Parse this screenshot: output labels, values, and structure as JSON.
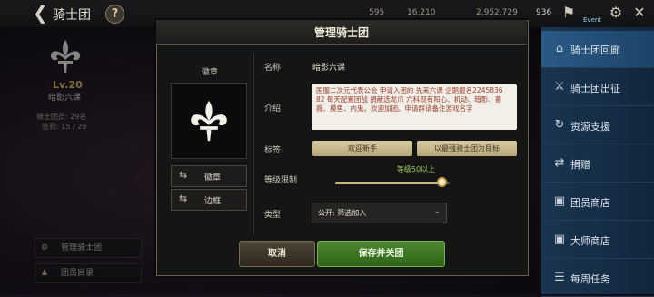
{
  "topbar": {
    "title": "骑士团",
    "help": "?",
    "currencies": [
      "595",
      "16,210",
      "2,952,729",
      "936"
    ],
    "notice": "Event"
  },
  "left_panel": {
    "level": "Lv.20",
    "guild_name": "暗影六课",
    "members": "骑士团员: 29名",
    "donate": "签到: 15 / 29",
    "manage_button": "管理骑士团",
    "member_list_button": "团员目录"
  },
  "sidebar": {
    "items": [
      {
        "label": "骑士团回廊",
        "icon": "home-icon"
      },
      {
        "label": "骑士团出征",
        "icon": "swords-icon"
      },
      {
        "label": "资源支援",
        "icon": "refresh-icon"
      },
      {
        "label": "捐赠",
        "icon": "shuffle-icon"
      },
      {
        "label": "团员商店",
        "icon": "shop-icon"
      },
      {
        "label": "大师商店",
        "icon": "shop-icon"
      },
      {
        "label": "每周任务",
        "icon": "list-icon"
      }
    ]
  },
  "modal": {
    "title": "管理骑士团",
    "emblem_label": "徽章",
    "emblem_button": "徽章",
    "frame_button": "边框",
    "name_label": "名称",
    "name_value": "暗影六课",
    "intro_label": "介绍",
    "intro_text": "国服二次元代表公会 申请入团的 先来六课 企鹅报名2245836 82 每天配置团战 捐献选龙爪 六科现有阳心、机动、暗影、薔薇、摸鱼、内鬼。欢迎加团。申请群请备注游戏名字",
    "tag_label": "标签",
    "tags": [
      "欢迎新手",
      "以最强骑士团为目标"
    ],
    "level_label": "等级限制",
    "level_value": "等级50以上",
    "level_fraction": 0.93,
    "type_label": "类型",
    "type_value": "公开: 筛选加入",
    "cancel_button": "取消",
    "save_button": "保存并关团"
  }
}
